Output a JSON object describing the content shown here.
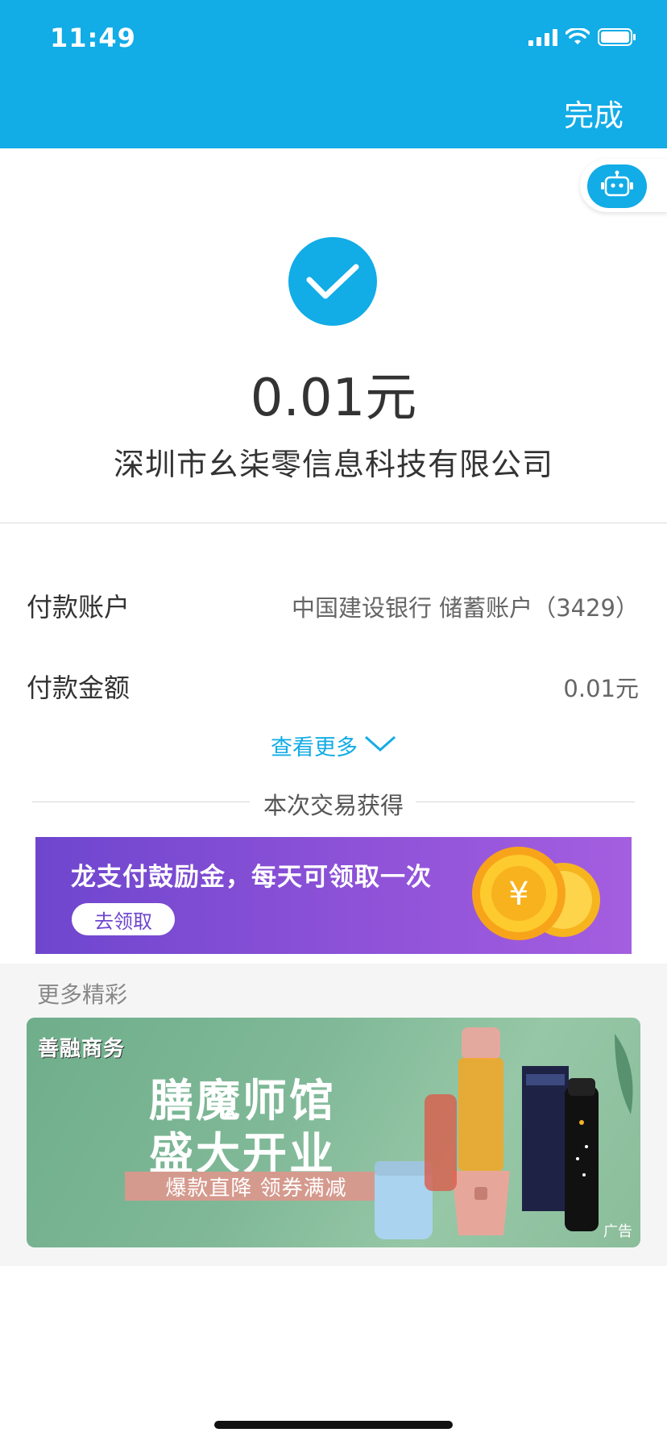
{
  "status_bar": {
    "time": "11:49"
  },
  "header": {
    "done_label": "完成"
  },
  "result": {
    "amount": "0.01元",
    "payee": "深圳市幺柒零信息科技有限公司"
  },
  "details": {
    "rows": [
      {
        "label": "付款账户",
        "value": "中国建设银行 储蓄账户（3429）"
      },
      {
        "label": "付款金额",
        "value": "0.01元"
      }
    ],
    "more_label": "查看更多"
  },
  "earned": {
    "title": "本次交易获得"
  },
  "promo": {
    "text": "龙支付鼓励金，每天可领取一次",
    "button_label": "去领取",
    "coin_symbol": "¥"
  },
  "more_section": {
    "title": "更多精彩",
    "ad": {
      "brand": "善融商务",
      "title_line1": "膳魔师馆",
      "title_line2": "盛大开业",
      "tagline": "爆款直降 领券满减",
      "ad_label": "广告"
    }
  },
  "colors": {
    "accent": "#12ace7",
    "promo": "#7a4bd2"
  }
}
